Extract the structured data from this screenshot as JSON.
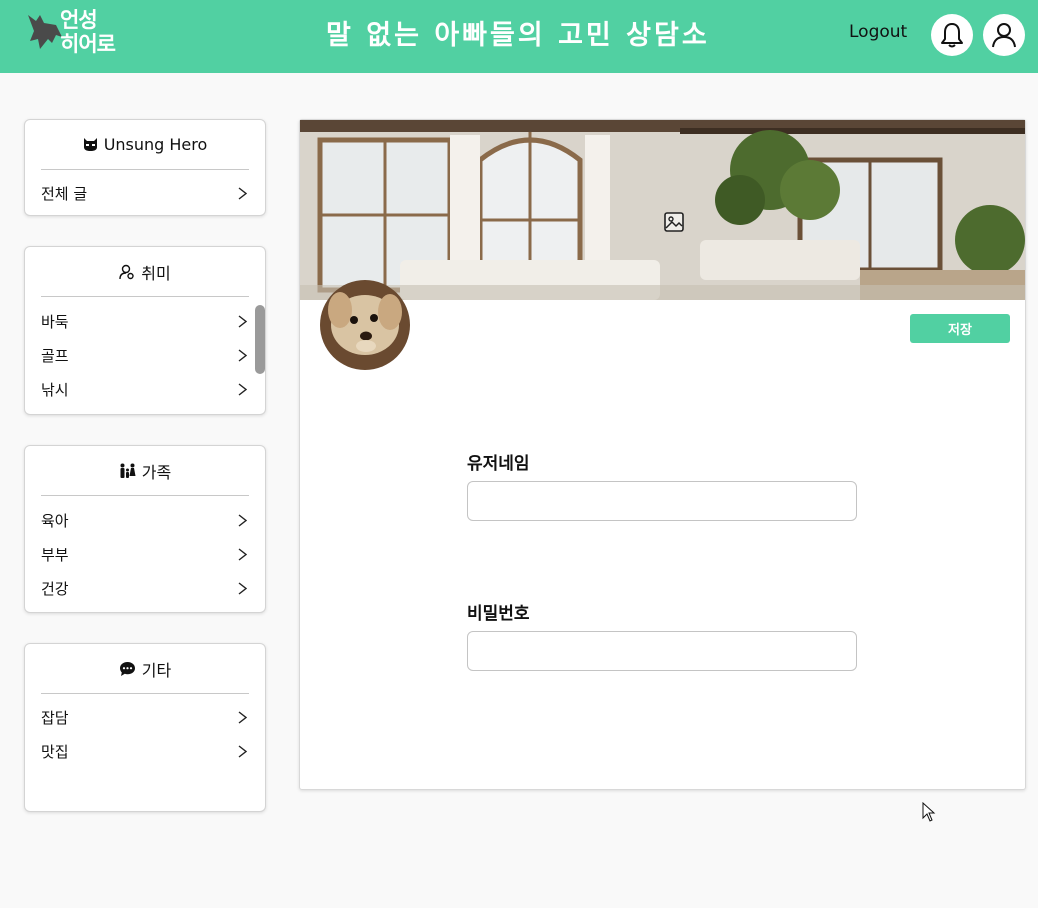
{
  "header": {
    "logo_line1": "언성",
    "logo_line2": "히어로",
    "site_title": "말 없는 아빠들의 고민 상담소",
    "logout_label": "Logout",
    "bell_icon": "bell-icon",
    "user_icon": "user-icon",
    "bg_color": "#51d0a2"
  },
  "sidebar": {
    "groups": [
      {
        "icon": "batman-mask-icon",
        "title": "Unsung Hero",
        "items": [
          {
            "label": "전체 글"
          }
        ]
      },
      {
        "icon": "person-search-icon",
        "title": "취미",
        "items": [
          {
            "label": "바둑"
          },
          {
            "label": "골프"
          },
          {
            "label": "낚시"
          }
        ]
      },
      {
        "icon": "family-icon",
        "title": "가족",
        "items": [
          {
            "label": "육아"
          },
          {
            "label": "부부"
          },
          {
            "label": "건강"
          }
        ]
      },
      {
        "icon": "chat-bubble-icon",
        "title": "기타",
        "items": [
          {
            "label": "잡담"
          },
          {
            "label": "맛집"
          }
        ]
      }
    ],
    "chevron_glyph": ">"
  },
  "profile": {
    "cover_icon": "image-icon",
    "save_label": "저장",
    "username_label": "유저네임",
    "username_value": "",
    "password_label": "비밀번호",
    "password_value": ""
  }
}
